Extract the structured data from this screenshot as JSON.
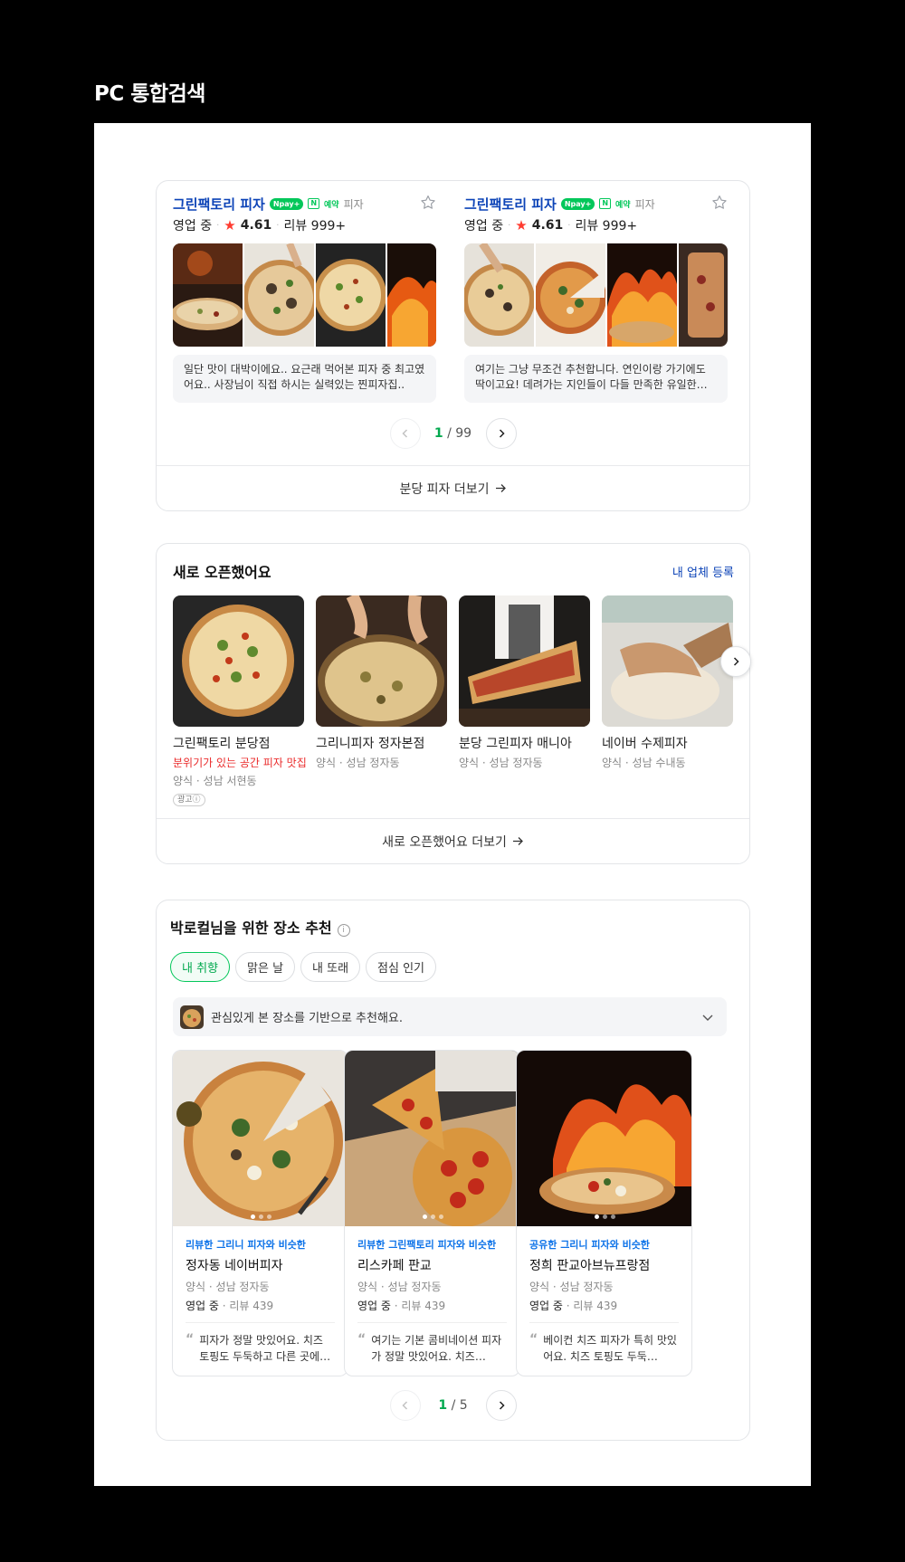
{
  "page_heading": "PC 통합검색",
  "card1": {
    "items": [
      {
        "name": "그린팩토리 피자",
        "npay": "Npay+",
        "nbadge": "N",
        "reservation": "예약",
        "category": "피자",
        "status": "영업 중",
        "rating": "4.61",
        "reviews": "리뷰 999+",
        "review_text": "일단 맛이 대박이에요.. 요근래 먹어본 피자 중 최고였어요.. 사장님이 직접 하시는 실력있는 찐피자집.."
      },
      {
        "name": "그린팩토리 피자",
        "npay": "Npay+",
        "nbadge": "N",
        "reservation": "예약",
        "category": "피자",
        "status": "영업 중",
        "rating": "4.61",
        "reviews": "리뷰 999+",
        "review_text": "여기는 그냥 무조건 추천합니다. 연인이랑 가기에도 딱이고요! 데려가는 지인들이 다들 만족한 유일한…"
      }
    ],
    "pager": {
      "current": "1",
      "total": "/ 99"
    },
    "more_label": "분당 피자 더보기"
  },
  "card2": {
    "title": "새로 오픈했어요",
    "link": "내 업체 등록",
    "items": [
      {
        "name": "그린팩토리 분당점",
        "promo": "분위기가 있는 공간 피자 맛집",
        "location": "양식 · 성남 서현동",
        "ad": "광고ⓘ"
      },
      {
        "name": "그리니피자 정자본점",
        "location": "양식 · 성남 정자동"
      },
      {
        "name": "분당 그린피자 매니아",
        "location": "양식 · 성남 정자동"
      },
      {
        "name": "네이버 수제피자",
        "location": "양식 · 성남 수내동"
      }
    ],
    "more_label": "새로 오픈했어요 더보기"
  },
  "card3": {
    "title": "박로컬님을 위한 장소 추천",
    "info": "i",
    "chips": [
      "내 취향",
      "맑은 날",
      "내 또래",
      "점심 인기"
    ],
    "basis_text": "관심있게 본 장소를 기반으로 추천해요.",
    "items": [
      {
        "reason": "리뷰한 그리니 피자와 비슷한",
        "name": "정자동 네이버피자",
        "location": "양식 · 성남 정자동",
        "status": "영업 중",
        "reviews": "리뷰 439",
        "quote": "피자가 정말 맛있어요. 치즈 토핑도 두둑하고 다른 곳에…"
      },
      {
        "reason": "리뷰한 그린팩토리 피자와 비슷한",
        "name": "리스카페 판교",
        "location": "양식 · 성남 정자동",
        "status": "영업 중",
        "reviews": "리뷰 439",
        "quote": "여기는 기본 콤비네이션 피자가 정말 맛있어요. 치즈…"
      },
      {
        "reason": "공유한 그리니 피자와 비슷한",
        "name": "정희 판교아브뉴프랑점",
        "location": "양식 · 성남 정자동",
        "status": "영업 중",
        "reviews": "리뷰 439",
        "quote": "베이컨 치즈 피자가 특히 맛있어요. 치즈 토핑도 두둑…"
      }
    ],
    "pager": {
      "current": "1",
      "total": "/ 5"
    }
  },
  "colors": {
    "brand_green": "#03c75a",
    "link_blue": "#0c43b7",
    "rating_red": "#ff3b30",
    "promo_red": "#ea2a2a"
  },
  "icons": [
    "star-outline-icon",
    "rating-star-icon",
    "chevron-left-icon",
    "chevron-right-icon",
    "arrow-right-icon",
    "info-icon",
    "chevron-down-icon",
    "quote-icon"
  ]
}
